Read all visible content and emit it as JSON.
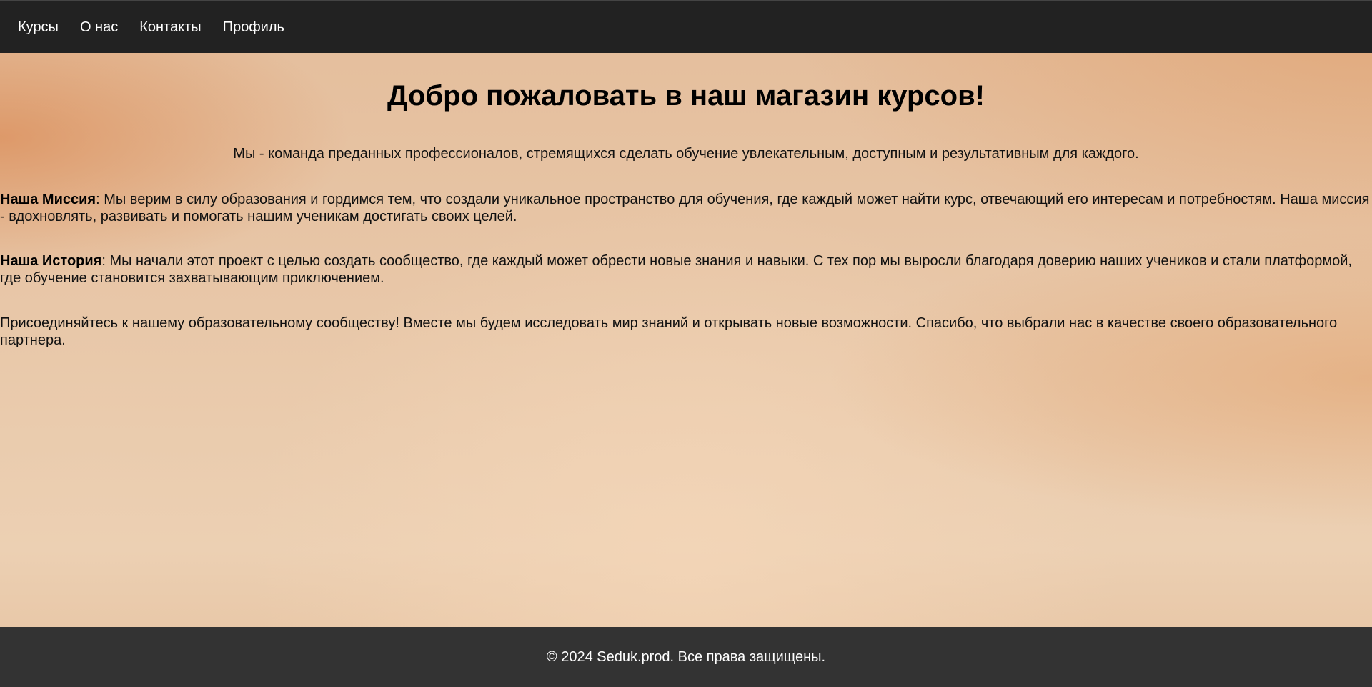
{
  "nav": {
    "items": [
      {
        "label": "Курсы"
      },
      {
        "label": "О нас"
      },
      {
        "label": "Контакты"
      },
      {
        "label": "Профиль"
      }
    ]
  },
  "main": {
    "title": "Добро пожаловать в наш магазин курсов!",
    "intro": "Мы - команда преданных профессионалов, стремящихся сделать обучение увлекательным, доступным и результативным для каждого.",
    "mission": {
      "heading": "Наша Миссия",
      "text": ": Мы верим в силу образования и гордимся тем, что создали уникальное пространство для обучения, где каждый может найти курс, отвечающий его интересам и потребностям. Наша миссия - вдохновлять, развивать и помогать нашим ученикам достигать своих целей."
    },
    "history": {
      "heading": "Наша История",
      "text": ": Мы начали этот проект с целью создать сообщество, где каждый может обрести новые знания и навыки. С тех пор мы выросли благодаря доверию наших учеников и стали платформой, где обучение становится захватывающим приключением."
    },
    "join": "Присоединяйтесь к нашему образовательному сообществу! Вместе мы будем исследовать мир знаний и открывать новые возможности. Спасибо, что выбрали нас в качестве своего образовательного партнера."
  },
  "footer": {
    "text": "© 2024 Seduk.prod. Все права защищены."
  },
  "colors": {
    "navbar_bg": "#222222",
    "footer_bg": "#333333",
    "page_bg": "#e8c7a8"
  }
}
